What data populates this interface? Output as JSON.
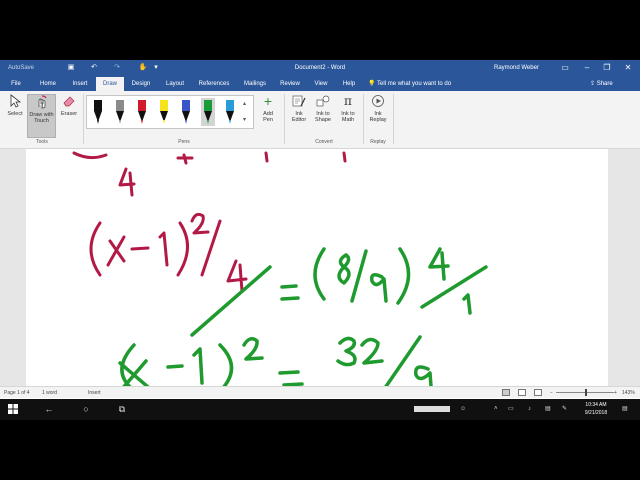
{
  "titlebar": {
    "autosave_label": "AutoSave",
    "title": "Document2 - Word",
    "user": "Raymond Weber"
  },
  "tabs": [
    {
      "label": "File",
      "active": false
    },
    {
      "label": "Home",
      "active": false
    },
    {
      "label": "Insert",
      "active": false
    },
    {
      "label": "Draw",
      "active": true
    },
    {
      "label": "Design",
      "active": false
    },
    {
      "label": "Layout",
      "active": false
    },
    {
      "label": "References",
      "active": false
    },
    {
      "label": "Mailings",
      "active": false
    },
    {
      "label": "Review",
      "active": false
    },
    {
      "label": "View",
      "active": false
    },
    {
      "label": "Help",
      "active": false
    }
  ],
  "tell_me": "Tell me what you want to do",
  "share_label": "Share",
  "ribbon": {
    "tools": {
      "select": "Select",
      "draw_touch_1": "Draw with",
      "draw_touch_2": "Touch",
      "eraser": "Eraser",
      "group": "Tools"
    },
    "pens": {
      "group": "Pens",
      "add_pen_1": "Add",
      "add_pen_2": "Pen",
      "colors": [
        "#111111",
        "#8a8a8a",
        "#d11b2a",
        "#f5e31b",
        "#3a55c8",
        "#1b9b3a",
        "#2a9bd8"
      ],
      "selected_index": 5
    },
    "convert": {
      "ink_editor_1": "Ink",
      "ink_editor_2": "Editor",
      "ink_shape_1": "Ink to",
      "ink_shape_2": "Shape",
      "ink_math_1": "Ink to",
      "ink_math_2": "Math",
      "group": "Convert"
    },
    "replay": {
      "ink_replay_1": "Ink",
      "ink_replay_2": "Replay",
      "group": "Replay"
    }
  },
  "status": {
    "page": "Page 1 of 4",
    "words": "1 word",
    "mode": "Insert",
    "zoom": "143%"
  },
  "clock": {
    "time": "10:34 AM",
    "date": "9/21/2018"
  },
  "ink_colors": {
    "red": "#b21a45",
    "green": "#1f9a2e"
  }
}
